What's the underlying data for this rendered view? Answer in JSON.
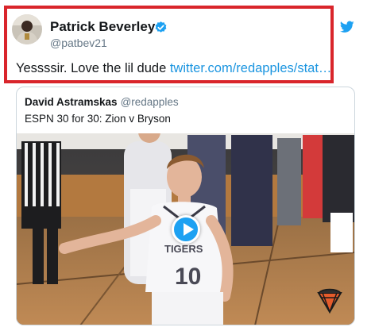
{
  "tweet": {
    "author_name": "Patrick Beverley",
    "author_handle": "@patbev21",
    "text_prefix": "Yessssir. Love the lil dude ",
    "link_text": "twitter.com/redapples/stat…"
  },
  "quoted_tweet": {
    "author_name": "David Astramskas",
    "author_handle": "@redapples",
    "text": "ESPN 30 for 30: Zion v Bryson"
  },
  "video": {
    "jersey_text": "10",
    "watermark": "espn-30-for-30-logo"
  },
  "icons": {
    "verified": "verified-badge-icon",
    "brand": "twitter-bird-icon",
    "play": "play-icon"
  },
  "colors": {
    "highlight_border": "#d9252b",
    "link": "#1b95e0",
    "twitter_blue": "#1da1f2"
  }
}
